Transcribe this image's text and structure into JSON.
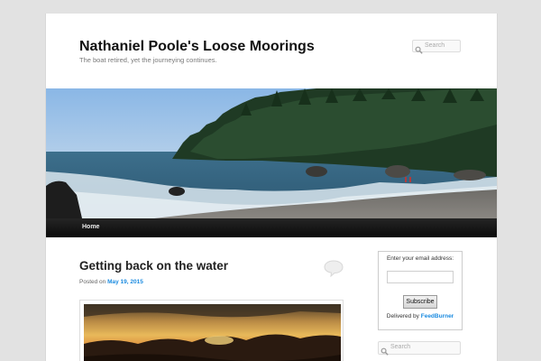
{
  "site": {
    "title": "Nathaniel Poole's Loose Moorings",
    "description": "The boat retired, yet the journeying continues."
  },
  "header_search": {
    "placeholder": "Search",
    "icon": "search-icon"
  },
  "nav": {
    "items": [
      {
        "label": "Home"
      }
    ]
  },
  "post": {
    "title": "Getting back on the water",
    "posted_on_label": "Posted on",
    "date": "May 19, 2015",
    "comment_icon": "comment-bubble-icon"
  },
  "subscribe": {
    "label": "Enter your email address:",
    "email_value": "",
    "button_label": "Subscribe",
    "delivered_by_label": "Delivered by",
    "feedburner_link": "FeedBurner"
  },
  "sidebar_search": {
    "placeholder": "Search",
    "icon": "search-icon"
  },
  "colors": {
    "link": "#1b8be0",
    "nav_background": "#111111",
    "page_background": "#e2e2e2"
  }
}
